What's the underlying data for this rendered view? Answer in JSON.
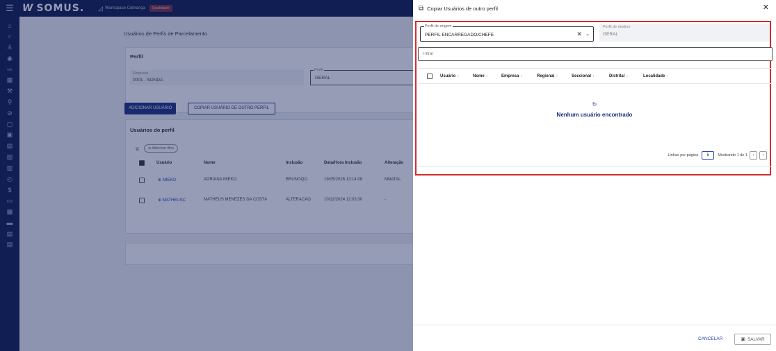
{
  "topbar": {
    "brand": "SOMUS.",
    "workspace": "Workspace Cobrança",
    "badge": "Qualidade"
  },
  "sidebar": {
    "icons": [
      "home-icon",
      "search-icon",
      "people-icon",
      "target-icon",
      "export-icon",
      "calendar-icon",
      "tool-icon",
      "wrench-icon",
      "block-icon",
      "folder-icon",
      "document-icon",
      "list-icon",
      "image-icon",
      "document-icon",
      "history-icon",
      "dollar-icon",
      "id-card-icon",
      "calculator-icon",
      "card-icon",
      "note-icon",
      "note-icon"
    ]
  },
  "background": {
    "page_title": "Usuários de Perfis de Parcelamento",
    "perfil_card": {
      "title": "Perfil",
      "empresa_label": "Empresa",
      "empresa_value": "0001 - SONDA",
      "perfil_label": "Perfil",
      "perfil_value": "GERAL"
    },
    "buttons": {
      "add_user": "ADICIONAR USUÁRIO",
      "copy_user": "COPIAR USUÁRIO DE OUTRO PERFIL"
    },
    "users_card": {
      "title": "Usuários do perfil",
      "add_filter": "Adicionar filtro",
      "columns": [
        "Usuário",
        "Nome",
        "Inclusão",
        "Data/Hora Inclusão",
        "Alteração"
      ],
      "rows": [
        {
          "usuario": "MIEKO",
          "nome": "ADRIANA MIEKO",
          "inclusao": "BRUNOQO",
          "data": "19/05/2026 13:14:08",
          "alteracao": "MNATAL"
        },
        {
          "usuario": "MATHEUSC",
          "nome": "MATHEUS MENEZES DA COSTA",
          "inclusao": "ALTERACAO",
          "data": "10/12/2024 12:03:30",
          "alteracao": "-"
        }
      ]
    }
  },
  "dialog": {
    "title": "Copiar Usuários de outro perfil",
    "origin_label": "Perfil de origem",
    "origin_value": "PERFIL ENCARREGADO/CHEFE",
    "dest_label": "Perfil de destino",
    "dest_value": "GERAL",
    "filter_placeholder": "Filtrar",
    "columns": [
      "Usuário",
      "Nome",
      "Empresa",
      "Regional",
      "Seccional",
      "Distrital",
      "Localidade"
    ],
    "empty_message": "Nenhum usuário encontrado",
    "pagination": {
      "rows_label": "Linhas por página",
      "rows_value": "5",
      "showing": "Mostrando 1 de 1"
    },
    "cancel_label": "CANCELAR",
    "save_label": "SALVAR"
  }
}
